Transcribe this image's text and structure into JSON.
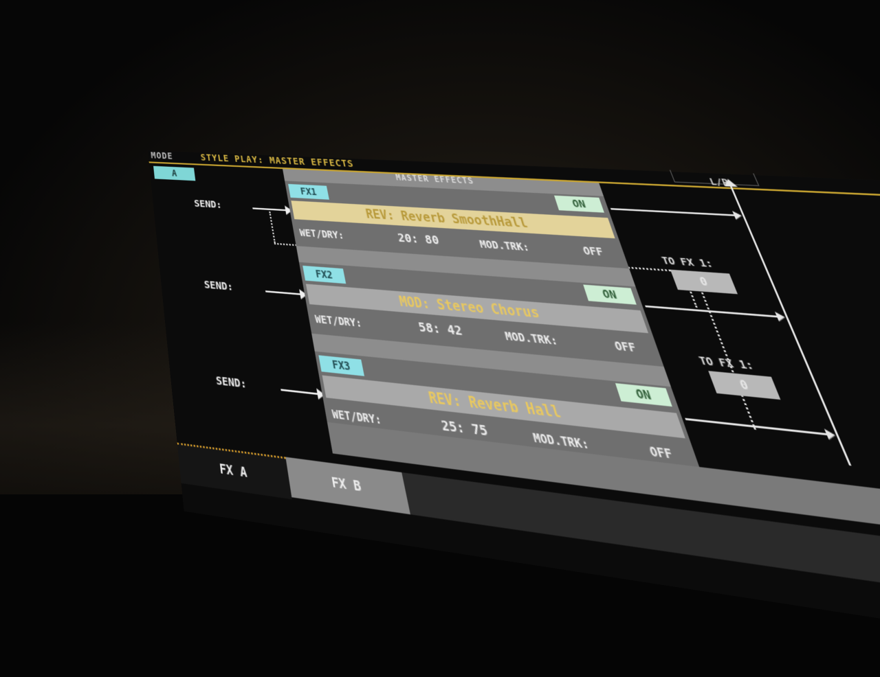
{
  "header": {
    "mode_label": "MODE",
    "mode_value": "STYLE PLAY: MASTER EFFECTS",
    "section_badge": "A",
    "output_label": "L/R"
  },
  "panel": {
    "title": "MASTER EFFECTS"
  },
  "fx": [
    {
      "tag": "FX1",
      "status": "ON",
      "name": "REV: Reverb SmoothHall",
      "wet_dry_label": "WET/DRY:",
      "wet_dry_value": "20: 80",
      "mod_trk_label": "MOD.TRK:",
      "mod_trk_value": "OFF",
      "send_label": "SEND:"
    },
    {
      "tag": "FX2",
      "status": "ON",
      "name": "MOD: Stereo Chorus",
      "wet_dry_label": "WET/DRY:",
      "wet_dry_value": "58: 42",
      "mod_trk_label": "MOD.TRK:",
      "mod_trk_value": "OFF",
      "send_label": "SEND:"
    },
    {
      "tag": "FX3",
      "status": "ON",
      "name": "REV: Reverb Hall",
      "wet_dry_label": "WET/DRY:",
      "wet_dry_value": "25: 75",
      "mod_trk_label": "MOD.TRK:",
      "mod_trk_value": "OFF",
      "send_label": "SEND:"
    }
  ],
  "to_fx": [
    {
      "label": "TO FX 1:",
      "value": "0"
    },
    {
      "label": "TO FX 1:",
      "value": "0"
    }
  ],
  "tabs": [
    {
      "label": "FX A",
      "selected": true
    },
    {
      "label": "FX B",
      "selected": false
    }
  ],
  "colors": {
    "accent_gold": "#c9a531",
    "fx_tag": "#8fe0e6",
    "on_button": "#cdeed4",
    "selected_name": "#e3d39a"
  }
}
